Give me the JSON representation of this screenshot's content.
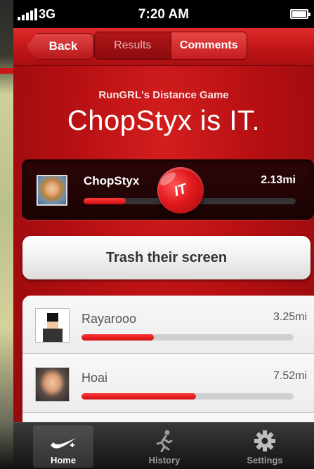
{
  "status_bar": {
    "carrier": "3G",
    "time": "7:20 AM"
  },
  "nav": {
    "back_label": "Back",
    "segments": [
      "Results",
      "Comments"
    ],
    "active_segment": "Comments"
  },
  "game": {
    "subtitle": "RunGRL's Distance Game",
    "headline": "ChopStyx is IT."
  },
  "it_player": {
    "name": "ChopStyx",
    "distance": "2.13mi",
    "progress": 0.2,
    "badge": "IT"
  },
  "actions": {
    "trash_label": "Trash their screen"
  },
  "leaderboard": [
    {
      "name": "Rayarooo",
      "distance": "3.25mi",
      "progress": 0.34
    },
    {
      "name": "Hoai",
      "distance": "7.52mi",
      "progress": 0.54
    },
    {
      "name": "",
      "distance": "",
      "progress": 0
    }
  ],
  "tabs": [
    {
      "label": "Home",
      "icon": "swoosh-icon",
      "active": true
    },
    {
      "label": "History",
      "icon": "runner-icon",
      "active": false
    },
    {
      "label": "Settings",
      "icon": "gear-icon",
      "active": false
    }
  ],
  "colors": {
    "accent": "#c41618",
    "progress": "#e0191c",
    "tab_bar": "#262626"
  }
}
